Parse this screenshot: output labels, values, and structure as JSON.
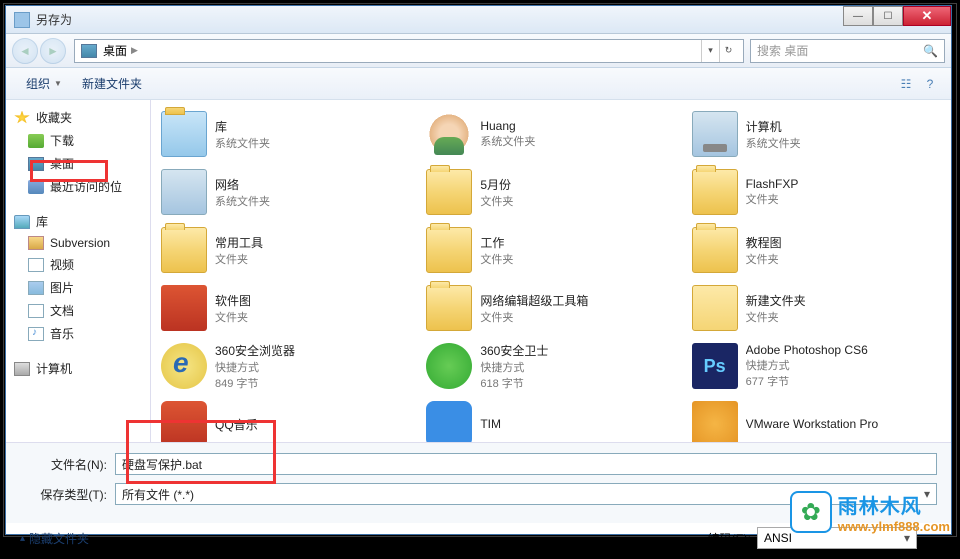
{
  "window": {
    "title": "另存为"
  },
  "nav": {
    "location": "桌面",
    "search_placeholder": "搜索 桌面"
  },
  "toolbar": {
    "organize": "组织",
    "new_folder": "新建文件夹"
  },
  "sidebar": {
    "favorites": {
      "label": "收藏夹",
      "items": [
        {
          "label": "下载"
        },
        {
          "label": "桌面"
        },
        {
          "label": "最近访问的位"
        }
      ]
    },
    "libraries": {
      "label": "库",
      "items": [
        {
          "label": "Subversion"
        },
        {
          "label": "视频"
        },
        {
          "label": "图片"
        },
        {
          "label": "文档"
        },
        {
          "label": "音乐"
        }
      ]
    },
    "computer": {
      "label": "计算机"
    }
  },
  "items": [
    {
      "icon": "libf",
      "name": "库",
      "type": "系统文件夹"
    },
    {
      "icon": "user",
      "name": "Huang",
      "type": "系统文件夹"
    },
    {
      "icon": "pc",
      "name": "计算机",
      "type": "系统文件夹"
    },
    {
      "icon": "net",
      "name": "网络",
      "type": "系统文件夹"
    },
    {
      "icon": "folder",
      "name": "5月份",
      "type": "文件夹"
    },
    {
      "icon": "folder",
      "name": "FlashFXP",
      "type": "文件夹"
    },
    {
      "icon": "folder",
      "name": "常用工具",
      "type": "文件夹"
    },
    {
      "icon": "folder",
      "name": "工作",
      "type": "文件夹"
    },
    {
      "icon": "folder",
      "name": "教程图",
      "type": "文件夹"
    },
    {
      "icon": "redbook",
      "name": "软件图",
      "type": "文件夹"
    },
    {
      "icon": "folder",
      "name": "网络编辑超级工具箱",
      "type": "文件夹"
    },
    {
      "icon": "folder2",
      "name": "新建文件夹",
      "type": "文件夹"
    },
    {
      "icon": "ie",
      "name": "360安全浏览器",
      "type": "快捷方式",
      "size": "849 字节"
    },
    {
      "icon": "g360",
      "name": "360安全卫士",
      "type": "快捷方式",
      "size": "618 字节"
    },
    {
      "icon": "ps",
      "name": "Adobe Photoshop CS6",
      "type": "快捷方式",
      "size": "677 字节"
    },
    {
      "icon": "qq",
      "name": "QQ音乐",
      "type": "",
      "size": ""
    },
    {
      "icon": "tim",
      "name": "TIM",
      "type": "",
      "size": ""
    },
    {
      "icon": "vm",
      "name": "VMware Workstation Pro",
      "type": "",
      "size": ""
    }
  ],
  "form": {
    "filename_label": "文件名(N):",
    "filename_value": "硬盘写保护.bat",
    "filetype_label": "保存类型(T):",
    "filetype_value": "所有文件 (*.*)",
    "hide_folders": "隐藏文件夹",
    "encoding_label": "编码(E):",
    "encoding_value": "ANSI"
  },
  "watermark": {
    "line1": "雨林木风",
    "line2": "www.ylmf888.com"
  }
}
